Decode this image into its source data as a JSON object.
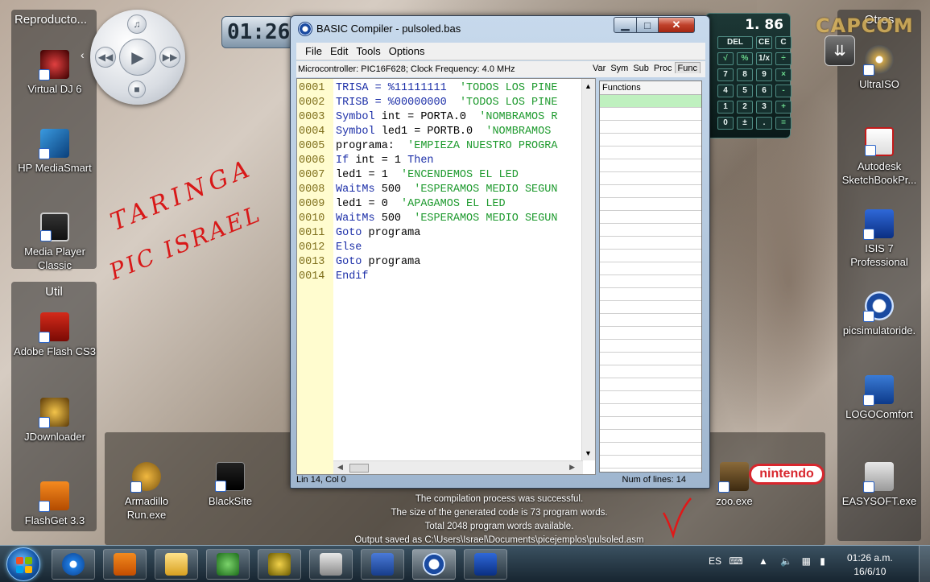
{
  "desktop": {
    "panels": {
      "left_top_title": "Reproducto...",
      "util_title": "Util",
      "right_top_title": "Otros"
    },
    "left_icons": [
      {
        "label": "Virtual DJ 6"
      },
      {
        "label": "HP MediaSmart"
      },
      {
        "label": "Media Player Classic"
      },
      {
        "label": "Adobe Flash CS3"
      },
      {
        "label": "JDownloader"
      },
      {
        "label": "FlashGet 3.3"
      }
    ],
    "bottom_icons": [
      {
        "label": "Armadillo Run.exe"
      },
      {
        "label": "BlackSite"
      },
      {
        "label": "zoo.exe"
      }
    ],
    "right_icons": [
      {
        "label": "UltraISO"
      },
      {
        "label": "Autodesk SketchBookPr..."
      },
      {
        "label": "ISIS 7 Professional"
      },
      {
        "label": "picsimulatoride."
      },
      {
        "label": "LOGOComfort"
      },
      {
        "label": "EASYSOFT.exe"
      }
    ],
    "clock_gadget": "01:26",
    "calculator": {
      "display": "1. 86",
      "keys": [
        "DEL",
        "CE",
        "C",
        "√",
        "%",
        "1/x",
        "÷",
        "7",
        "8",
        "9",
        "×",
        "4",
        "5",
        "6",
        "-",
        "1",
        "2",
        "3",
        "+",
        "0",
        "±",
        ".",
        "="
      ]
    },
    "capcom": "CAPCOM",
    "handwriting_1": "TARINGA",
    "handwriting_2": "PIC ISRAEL"
  },
  "window": {
    "title": "BASIC Compiler - pulsoled.bas",
    "menu": [
      "File",
      "Edit",
      "Tools",
      "Options"
    ],
    "info": "Microcontroller: PIC16F628;  Clock Frequency: 4.0 MHz",
    "tabs": [
      "Var",
      "Sym",
      "Sub",
      "Proc",
      "Func"
    ],
    "functions_header": "Functions",
    "code": [
      {
        "n": "0001",
        "parts": [
          {
            "t": "TRISA = %11111111  ",
            "c": "kw"
          },
          {
            "t": "'TODOS LOS PINE",
            "c": "cm"
          }
        ]
      },
      {
        "n": "0002",
        "parts": [
          {
            "t": "TRISB = %00000000  ",
            "c": "kw"
          },
          {
            "t": "'TODOS LOS PINE",
            "c": "cm"
          }
        ]
      },
      {
        "n": "0003",
        "parts": [
          {
            "t": "Symbol ",
            "c": "kw"
          },
          {
            "t": "int = PORTA.0  ",
            "c": "tx"
          },
          {
            "t": "'NOMBRAMOS R",
            "c": "cm"
          }
        ]
      },
      {
        "n": "0004",
        "parts": [
          {
            "t": "Symbol ",
            "c": "kw"
          },
          {
            "t": "led1 = PORTB.0  ",
            "c": "tx"
          },
          {
            "t": "'NOMBRAMOS",
            "c": "cm"
          }
        ]
      },
      {
        "n": "0005",
        "parts": [
          {
            "t": "programa:  ",
            "c": "tx"
          },
          {
            "t": "'EMPIEZA NUESTRO PROGRA",
            "c": "cm"
          }
        ]
      },
      {
        "n": "0006",
        "parts": [
          {
            "t": "If ",
            "c": "kw"
          },
          {
            "t": "int = 1 ",
            "c": "tx"
          },
          {
            "t": "Then",
            "c": "kw"
          }
        ]
      },
      {
        "n": "0007",
        "parts": [
          {
            "t": "led1 = 1  ",
            "c": "tx"
          },
          {
            "t": "'ENCENDEMOS EL LED",
            "c": "cm"
          }
        ]
      },
      {
        "n": "0008",
        "parts": [
          {
            "t": "WaitMs ",
            "c": "kw"
          },
          {
            "t": "500  ",
            "c": "tx"
          },
          {
            "t": "'ESPERAMOS MEDIO SEGUN",
            "c": "cm"
          }
        ]
      },
      {
        "n": "0009",
        "parts": [
          {
            "t": "led1 = 0  ",
            "c": "tx"
          },
          {
            "t": "'APAGAMOS EL LED",
            "c": "cm"
          }
        ]
      },
      {
        "n": "0010",
        "parts": [
          {
            "t": "WaitMs ",
            "c": "kw"
          },
          {
            "t": "500  ",
            "c": "tx"
          },
          {
            "t": "'ESPERAMOS MEDIO SEGUN",
            "c": "cm"
          }
        ]
      },
      {
        "n": "0011",
        "parts": [
          {
            "t": "Goto ",
            "c": "kw"
          },
          {
            "t": "programa",
            "c": "tx"
          }
        ]
      },
      {
        "n": "0012",
        "parts": [
          {
            "t": "Else",
            "c": "kw"
          }
        ]
      },
      {
        "n": "0013",
        "parts": [
          {
            "t": "Goto ",
            "c": "kw"
          },
          {
            "t": "programa",
            "c": "tx"
          }
        ]
      },
      {
        "n": "0014",
        "parts": [
          {
            "t": "Endif",
            "c": "kw"
          }
        ]
      }
    ],
    "status_left": "Lin 14, Col 0",
    "status_right": "Num of lines: 14"
  },
  "output": [
    "The compilation process was successful.",
    "The size of the generated code is 73 program words.",
    "Total 2048 program words available.",
    "Output saved as C:\\Users\\Israel\\Documents\\picejemplos\\pulsoled.asm"
  ],
  "taskbar": {
    "language": "ES",
    "time": "01:26 a.m.",
    "date": "16/6/10",
    "apps": [
      "ie-icon",
      "media-player-icon",
      "folder-icon",
      "messenger-icon",
      "antivirus-icon",
      "search-icon",
      "word-icon",
      "basic-compiler-icon",
      "isis-icon"
    ]
  },
  "colors": {
    "keyword": "#1c2fa8",
    "comment": "#1e9a2e",
    "gutter": "#fffccf",
    "selected_row": "#bff0bf"
  }
}
